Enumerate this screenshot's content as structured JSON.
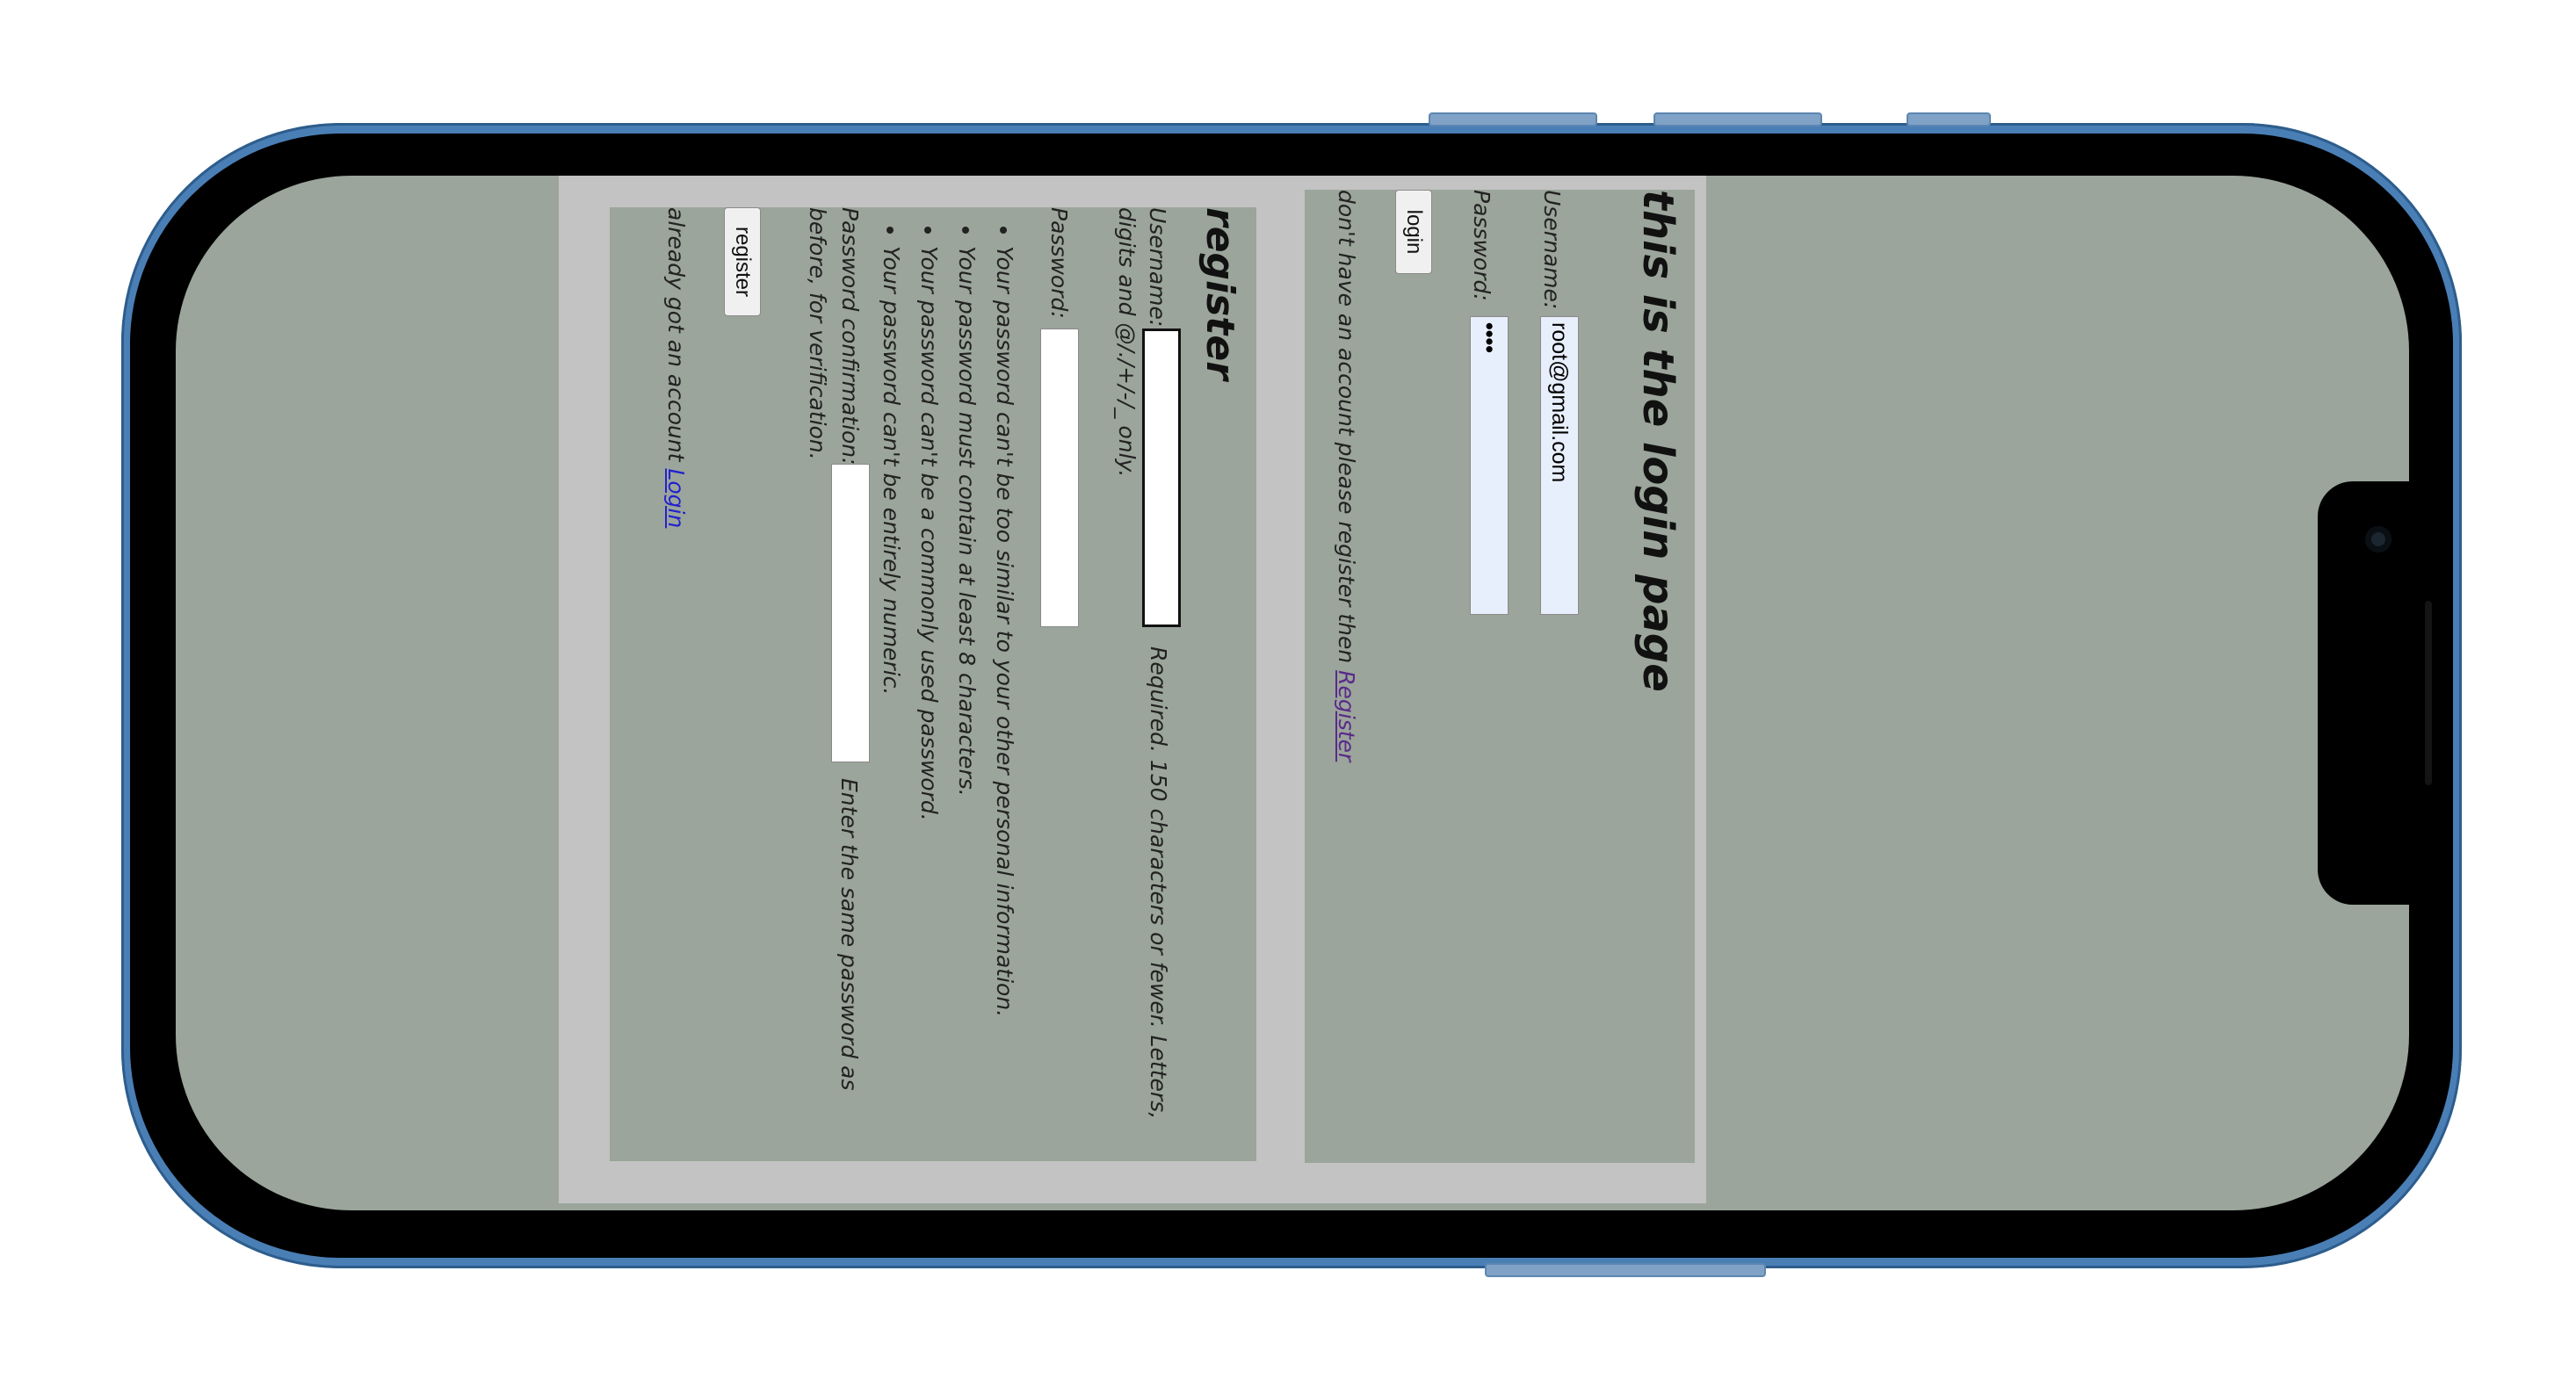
{
  "login": {
    "title": "this is the login page",
    "username_label": "Username:",
    "username_value": "root@gmail.com",
    "password_label": "Password:",
    "password_value": "••••",
    "login_button": "login",
    "no_account_text": "don't have an account please register then ",
    "register_link": "Register"
  },
  "register": {
    "title": "register",
    "username_label": "Username:",
    "username_help": "Required. 150 characters or fewer. Letters, digits and @/./+/-/_ only.",
    "password_label": "Password:",
    "password_rules": [
      "Your password can't be too similar to your other personal information.",
      "Your password must contain at least 8 characters.",
      "Your password can't be a commonly used password.",
      "Your password can't be entirely numeric."
    ],
    "confirm_label": "Password confirmation:",
    "confirm_help": "Enter the same password as before, for verification.",
    "register_button": "register",
    "have_account_text": "already got an account ",
    "login_link": "Login"
  },
  "colors": {
    "page_bg": "#9ba59b",
    "panel_border": "#c3c3c3",
    "phone_frame": "#4a7fb6",
    "link": "#2222cc",
    "visited_link": "#5a2a8a"
  }
}
